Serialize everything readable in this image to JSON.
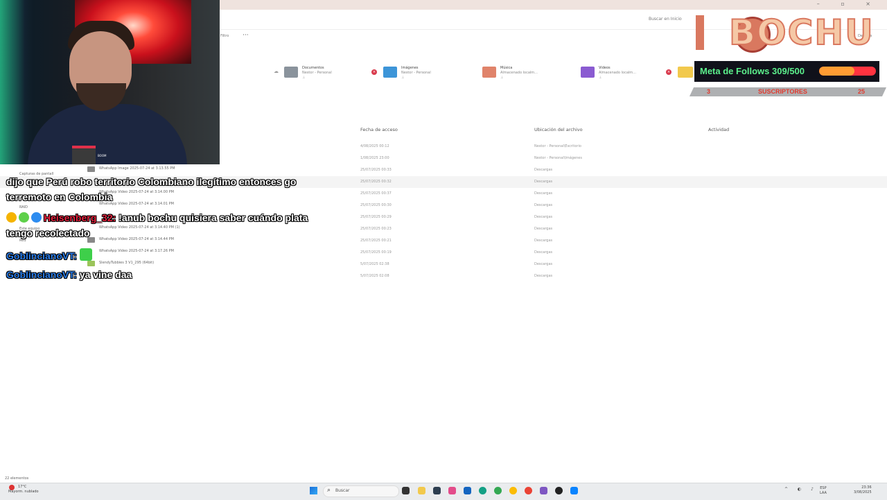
{
  "explorer": {
    "search_placeholder": "Buscar en Inicio",
    "filter_label": "Filtro",
    "more_label": "···",
    "details_label": "Detalles",
    "quick_access": [
      {
        "title": "Documentos",
        "subtitle": "Nestor - Personal",
        "color": "#8a939c"
      },
      {
        "title": "Imágenes",
        "subtitle": "Nestor - Personal",
        "color": "#3d95d8"
      },
      {
        "title": "Música",
        "subtitle": "Almacenado localm...",
        "color": "#e0836a"
      },
      {
        "title": "Videos",
        "subtitle": "Almacenado localm...",
        "color": "#8a5bd1"
      }
    ],
    "columns": {
      "access": "Fecha de acceso",
      "location": "Ubicación del archivo",
      "activity": "Actividad"
    },
    "rows": [
      {
        "name": "",
        "date": "4/08/2025 00:12",
        "location": "Nestor - Personal\\Escritorio"
      },
      {
        "name": "",
        "date": "1/08/2025 23:00",
        "location": "Nestor - Personal\\Imágenes"
      },
      {
        "name": "WhatsApp Image 2025-07-24 at 3.13.55 PM",
        "date": "25/07/2025 00:33",
        "location": "Descargas"
      },
      {
        "name": "",
        "date": "25/07/2025 00:32",
        "location": "Descargas"
      },
      {
        "name": "WhatsApp Video 2025-07-24 at 3.14.00 PM",
        "date": "25/07/2025 00:37",
        "location": "Descargas"
      },
      {
        "name": "WhatsApp Video 2025-07-24 at 3.14.01 PM",
        "date": "25/07/2025 00:30",
        "location": "Descargas"
      },
      {
        "name": "",
        "date": "25/07/2025 00:29",
        "location": "Descargas"
      },
      {
        "name": "WhatsApp Video 2025-07-24 at 3.14.40 PM (1)",
        "date": "25/07/2025 00:23",
        "location": "Descargas"
      },
      {
        "name": "WhatsApp Video 2025-07-24 at 3.14.44 PM",
        "date": "25/07/2025 00:21",
        "location": "Descargas"
      },
      {
        "name": "WhatsApp Video 2025-07-24 at 3.17.26 PM",
        "date": "25/07/2025 00:19",
        "location": "Descargas"
      },
      {
        "name": "SlendyTubbies 3 V1_295 (64bit)",
        "date": "5/07/2025 02:38",
        "location": "Descargas"
      },
      {
        "name": "",
        "date": "5/07/2025 02:08",
        "location": "Descargas"
      }
    ],
    "sidebar": {
      "captures": "Capturas de pantall",
      "raid": "RAID",
      "this_pc": "Este equipo",
      "network": "Red"
    },
    "item_count": "22 elementos"
  },
  "overlay": {
    "logo_text": "BOCHU",
    "follow_label": "Meta de Follows 309/500",
    "follow_progress": 0.618,
    "subs_left": "3",
    "subs_label": "SUSCRIPTORES",
    "subs_right": "25",
    "mic_label": "BOOM"
  },
  "chat": [
    {
      "user": "",
      "text": "dijo que Perú robo territorio Colombiano ilegítimo entonces go",
      "text2": "terremoto en Colombia"
    },
    {
      "user": "Heisenberg_32:",
      "text": "!anub bochu quisiera saber cuándo plata",
      "text2": "tengo recolectado"
    },
    {
      "user": "GoblincianoVT:",
      "text": ""
    },
    {
      "user": "GoblincianoVT:",
      "text": "ya vine daa"
    }
  ],
  "taskbar": {
    "weather_temp": "17°C",
    "weather_desc": "Mayorm. nublado",
    "search_label": "Buscar",
    "lang_top": "ESP",
    "lang_bottom": "LAA",
    "time": "23:36",
    "date": "3/08/2025"
  }
}
